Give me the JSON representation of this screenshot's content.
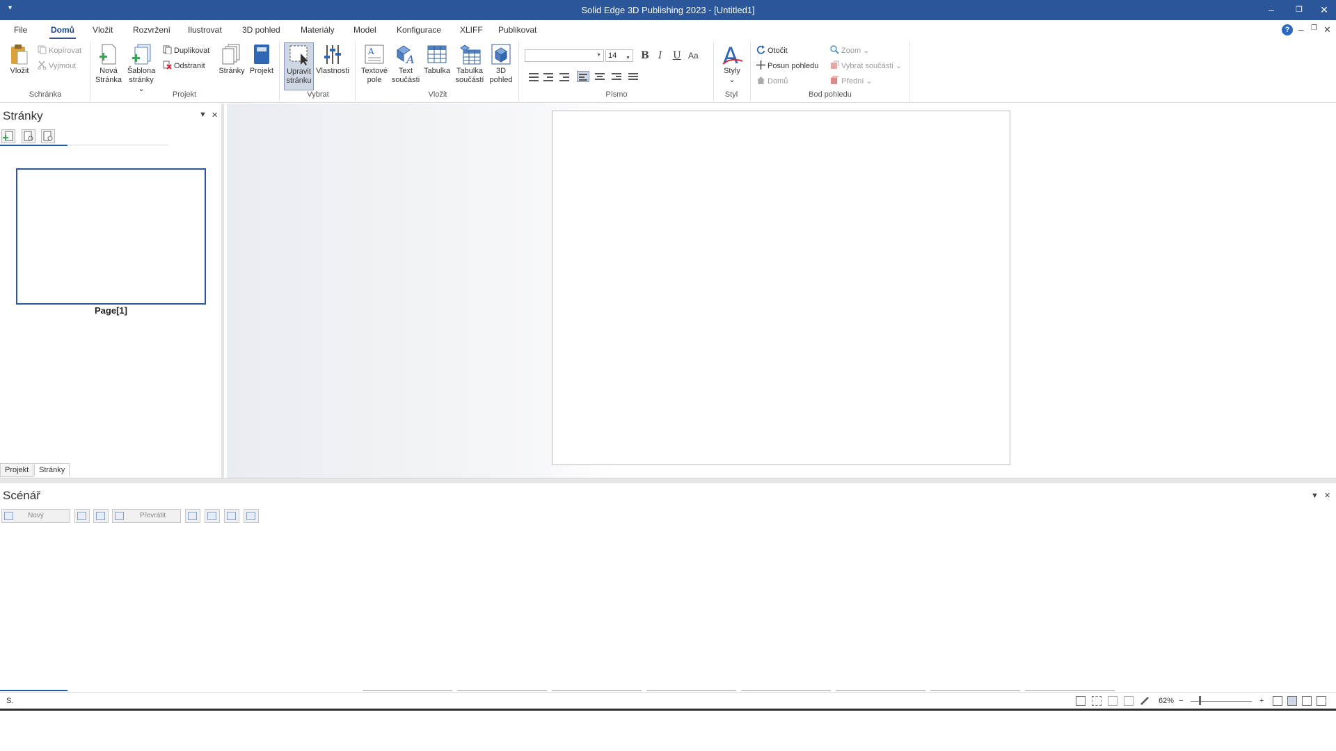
{
  "window": {
    "title": "Solid Edge 3D Publishing  2023 - [Untitled1]",
    "qa_icon": "quick-access-arrow",
    "minimize": "–",
    "restore": "❐",
    "close": "✕"
  },
  "menu": {
    "items": [
      "File",
      "Domů",
      "Vložit",
      "Rozvržení",
      "Ilustrovat",
      "3D pohled",
      "Materiály",
      "Model",
      "Konfigurace",
      "XLIFF",
      "Publikovat"
    ],
    "active": "Domů",
    "help": "?"
  },
  "ribbon": {
    "clipboard": {
      "label": "Schránka",
      "paste": "Vložit",
      "copy": "Kopírovat",
      "cut": "Vyjmout"
    },
    "project": {
      "label": "Projekt",
      "new_page_1": "Nová",
      "new_page_2": "Stránka",
      "template_1": "Šablona",
      "template_2": "stránky",
      "duplicate": "Duplikovat",
      "delete": "Odstranit",
      "pages": "Stránky",
      "project": "Projekt"
    },
    "select": {
      "label": "Vybrat",
      "edit_page_1": "Upravit",
      "edit_page_2": "stránku",
      "properties": "Vlastnosti"
    },
    "insert": {
      "label": "Vložit",
      "textbox_1": "Textové",
      "textbox_2": "pole",
      "parttext_1": "Text",
      "parttext_2": "součásti",
      "table": "Tabulka",
      "parttable_1": "Tabulka",
      "parttable_2": "součástí",
      "view3d_1": "3D",
      "view3d_2": "pohled"
    },
    "font": {
      "label": "Písmo",
      "family": "",
      "size": "14",
      "bold": "B",
      "italic": "I",
      "underline": "U",
      "case": "Aa"
    },
    "style": {
      "label": "Styl",
      "styles": "Styly"
    },
    "viewpoint": {
      "label": "Bod pohledu",
      "rotate": "Otočit",
      "pan": "Posun pohledu",
      "home": "Domů",
      "zoom": "Zoom",
      "select_parts": "Vybrat součásti",
      "front": "Přední"
    }
  },
  "pages_panel": {
    "title": "Stránky",
    "page_label": "Page[1]",
    "tabs": [
      "Projekt",
      "Stránky"
    ],
    "active_tab": "Stránky"
  },
  "scenario_panel": {
    "title": "Scénář",
    "new": "Nový",
    "convert": "Převrátit"
  },
  "status": {
    "left": "S.",
    "zoom": "62%",
    "zoom_minus": "−",
    "zoom_plus": "+",
    "zoom_fraction": 0.14
  },
  "colors": {
    "title_bar": "#2b579a",
    "accent": "#2b579a"
  }
}
